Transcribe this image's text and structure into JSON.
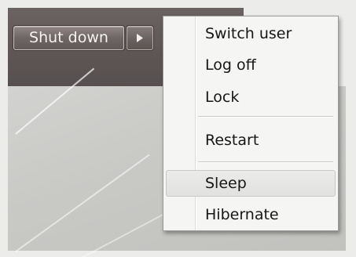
{
  "shutdown": {
    "button_label": "Shut down",
    "arrow_icon": "triangle-right-icon"
  },
  "menu": {
    "items": [
      {
        "label": "Switch user"
      },
      {
        "label": "Log off"
      },
      {
        "label": "Lock"
      },
      {
        "label": "Restart"
      },
      {
        "label": "Sleep",
        "highlighted": true
      },
      {
        "label": "Hibernate"
      }
    ]
  },
  "colors": {
    "menu_bg": "#f5f5f4",
    "start_strip": "#5d5655",
    "button_text": "#f4f2f2",
    "highlight": "#e1e1df"
  }
}
